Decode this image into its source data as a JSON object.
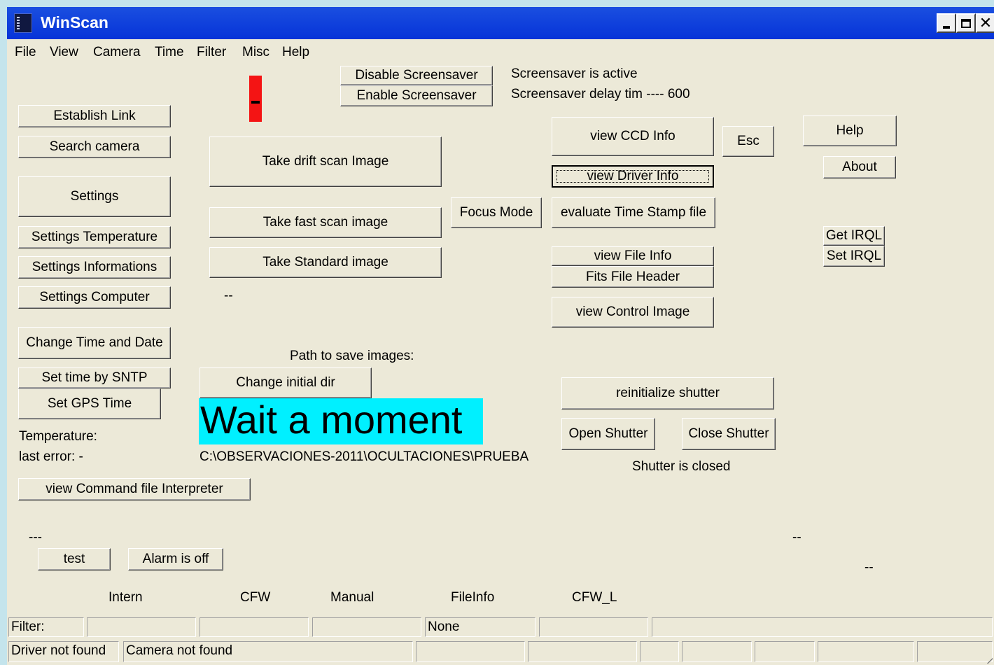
{
  "window": {
    "title": "WinScan",
    "app_icon": "winscan-app-icon",
    "controls": {
      "minimize": "minimize-icon",
      "maximize": "maximize-icon",
      "close": "close-icon",
      "close_glyph": "✕"
    }
  },
  "menu": [
    "File",
    "View",
    "Camera",
    "Time",
    "Filter",
    "Misc",
    "Help"
  ],
  "buttons": {
    "establish_link": "Establish Link",
    "search_camera": "Search camera",
    "settings": "Settings",
    "settings_temperature": "Settings Temperature",
    "settings_informations": "Settings Informations",
    "settings_computer": "Settings Computer",
    "change_time_date": "Change Time and Date",
    "set_time_sntp": "Set time by SNTP",
    "set_gps_time": "Set GPS Time",
    "view_command_file": "view Command file Interpreter",
    "test": "test",
    "alarm": "Alarm is off",
    "disable_screensaver": "Disable Screensaver",
    "enable_screensaver": "Enable Screensaver",
    "drift_scan": "Take drift scan Image",
    "fast_scan": "Take fast scan image",
    "standard_image": "Take Standard image",
    "focus_mode": "Focus Mode",
    "change_initial_dir": "Change initial dir",
    "view_ccd_info": "view CCD Info",
    "esc": "Esc",
    "view_driver_info": "view Driver Info",
    "evaluate_timestamp": "evaluate Time Stamp file",
    "view_file_info": "view    File Info",
    "fits_file_header": "Fits File Header",
    "view_control_image": "view  Control Image",
    "help": "Help",
    "about": "About",
    "get_irql": "Get IRQL",
    "set_irql": "Set IRQL",
    "reinitialize_shutter": "reinitialize shutter",
    "open_shutter": "Open Shutter",
    "close_shutter": "Close Shutter"
  },
  "status": {
    "screensaver_active": "Screensaver is active",
    "screensaver_delay": "Screensaver delay tim ---- 600",
    "temperature": "Temperature:",
    "last_error": "last error:  -",
    "path_label": "Path to save images:",
    "save_path": "C:\\OBSERVACIONES-2011\\OCULTACIONES\\PRUEBA",
    "wait_message": "Wait a moment",
    "shutter_state": "Shutter is closed",
    "dash_mid": "--",
    "dash_left": "---",
    "dash_right_1": "--",
    "dash_right_2": "--"
  },
  "filter_labels": [
    "Intern",
    "CFW",
    "Manual",
    "FileInfo",
    "CFW_L"
  ],
  "statusbar": {
    "row1": [
      "Filter:",
      "",
      "",
      "",
      "None",
      "",
      ""
    ],
    "row2": [
      "Driver not found",
      "Camera not found",
      "",
      "",
      "",
      "",
      "",
      "",
      ""
    ]
  },
  "colors": {
    "title_bar": "#0633d8",
    "window_bg": "#ece9d8",
    "indicator": "#f41414",
    "wait_banner": "#00f0ff"
  }
}
